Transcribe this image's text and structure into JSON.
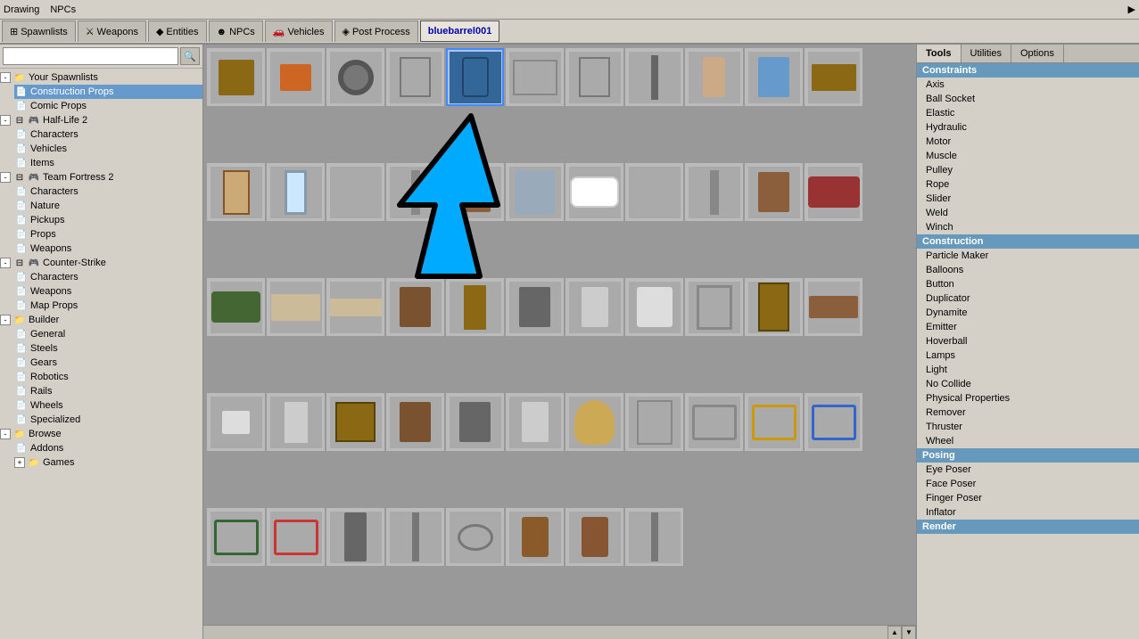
{
  "topMenu": {
    "items": [
      "Drawing",
      "NPCs"
    ],
    "arrowLabel": "▶"
  },
  "tabs": [
    {
      "label": "Spawnlists",
      "icon": "grid",
      "active": false
    },
    {
      "label": "Weapons",
      "icon": "weapon",
      "active": false
    },
    {
      "label": "Entities",
      "icon": "entity",
      "active": false
    },
    {
      "label": "NPCs",
      "icon": "npc",
      "active": false
    },
    {
      "label": "Vehicles",
      "icon": "vehicle",
      "active": false
    },
    {
      "label": "Post Process",
      "icon": "post",
      "active": false
    },
    {
      "label": "bluebarrel001",
      "icon": "tab",
      "active": true
    }
  ],
  "search": {
    "placeholder": "",
    "value": ""
  },
  "tree": {
    "sections": [
      {
        "id": "your-spawnlists",
        "label": "Your Spawnlists",
        "icon": "folder",
        "expanded": true,
        "children": [
          {
            "id": "construction-props",
            "label": "Construction Props",
            "icon": "file",
            "selected": true
          },
          {
            "id": "comic-props",
            "label": "Comic Props",
            "icon": "file",
            "selected": false
          }
        ]
      },
      {
        "id": "half-life-2",
        "label": "Half-Life 2",
        "icon": "folder",
        "expanded": true,
        "children": [
          {
            "id": "hl2-characters",
            "label": "Characters",
            "icon": "file",
            "selected": false
          },
          {
            "id": "hl2-vehicles",
            "label": "Vehicles",
            "icon": "file",
            "selected": false
          },
          {
            "id": "hl2-items",
            "label": "Items",
            "icon": "file",
            "selected": false
          }
        ]
      },
      {
        "id": "team-fortress-2",
        "label": "Team Fortress 2",
        "icon": "folder",
        "expanded": true,
        "children": [
          {
            "id": "tf2-characters",
            "label": "Characters",
            "icon": "file",
            "selected": false
          },
          {
            "id": "tf2-nature",
            "label": "Nature",
            "icon": "file",
            "selected": false
          },
          {
            "id": "tf2-pickups",
            "label": "Pickups",
            "icon": "file",
            "selected": false
          },
          {
            "id": "tf2-props",
            "label": "Props",
            "icon": "file",
            "selected": false
          },
          {
            "id": "tf2-weapons",
            "label": "Weapons",
            "icon": "file",
            "selected": false
          }
        ]
      },
      {
        "id": "counter-strike",
        "label": "Counter-Strike",
        "icon": "folder",
        "expanded": true,
        "children": [
          {
            "id": "cs-characters",
            "label": "Characters",
            "icon": "file",
            "selected": false
          },
          {
            "id": "cs-weapons",
            "label": "Weapons",
            "icon": "file",
            "selected": false
          },
          {
            "id": "cs-map-props",
            "label": "Map Props",
            "icon": "file",
            "selected": false
          }
        ]
      },
      {
        "id": "builder",
        "label": "Builder",
        "icon": "folder",
        "expanded": true,
        "children": [
          {
            "id": "builder-general",
            "label": "General",
            "icon": "file",
            "selected": false
          },
          {
            "id": "builder-steels",
            "label": "Steels",
            "icon": "file",
            "selected": false
          },
          {
            "id": "builder-gears",
            "label": "Gears",
            "icon": "file",
            "selected": false
          },
          {
            "id": "builder-robotics",
            "label": "Robotics",
            "icon": "file",
            "selected": false
          },
          {
            "id": "builder-rails",
            "label": "Rails",
            "icon": "file",
            "selected": false
          },
          {
            "id": "builder-wheels",
            "label": "Wheels",
            "icon": "file",
            "selected": false
          },
          {
            "id": "builder-specialized",
            "label": "Specialized",
            "icon": "file",
            "selected": false
          }
        ]
      },
      {
        "id": "browse",
        "label": "Browse",
        "icon": "folder",
        "expanded": true,
        "children": [
          {
            "id": "browse-addons",
            "label": "Addons",
            "icon": "file",
            "selected": false
          },
          {
            "id": "browse-games",
            "label": "Games",
            "icon": "folder",
            "selected": false
          }
        ]
      }
    ]
  },
  "rightPanel": {
    "tabs": [
      {
        "label": "Tools",
        "active": true
      },
      {
        "label": "Utilities",
        "active": false
      },
      {
        "label": "Options",
        "active": false
      }
    ],
    "sections": [
      {
        "header": "Constraints",
        "items": [
          "Axis",
          "Ball Socket",
          "Elastic",
          "Hydraulic",
          "Motor",
          "Muscle",
          "Pulley",
          "Rope",
          "Slider",
          "Weld",
          "Winch"
        ]
      },
      {
        "header": "Construction",
        "items": [
          "Particle Maker",
          "Balloons",
          "Button",
          "Duplicator",
          "Dynamite",
          "Emitter",
          "Hoverball",
          "Lamps",
          "Light",
          "No Collide",
          "Physical Properties",
          "Remover",
          "Thruster",
          "Wheel"
        ]
      },
      {
        "header": "Posing",
        "items": [
          "Eye Poser",
          "Face Poser",
          "Finger Poser",
          "Inflator"
        ]
      },
      {
        "header": "Render",
        "items": []
      }
    ]
  },
  "gridItems": [
    {
      "shape": "stool",
      "selected": false
    },
    {
      "shape": "cans",
      "selected": false
    },
    {
      "shape": "wheel",
      "selected": false
    },
    {
      "shape": "panel",
      "selected": false
    },
    {
      "shape": "barrel",
      "selected": true
    },
    {
      "shape": "fence",
      "selected": false
    },
    {
      "shape": "panel",
      "selected": false
    },
    {
      "shape": "rod",
      "selected": false
    },
    {
      "shape": "barrel2",
      "selected": false
    },
    {
      "shape": "chair",
      "selected": false
    },
    {
      "shape": "table",
      "selected": false
    },
    {
      "shape": "door",
      "selected": false
    },
    {
      "shape": "mirror",
      "selected": false
    },
    {
      "shape": "fence2",
      "selected": false
    },
    {
      "shape": "post",
      "selected": false
    },
    {
      "shape": "woodchair",
      "selected": false
    },
    {
      "shape": "fountain",
      "selected": false
    },
    {
      "shape": "tub",
      "selected": false
    },
    {
      "shape": "fence2",
      "selected": false
    },
    {
      "shape": "rod",
      "selected": false
    },
    {
      "shape": "woodchair",
      "selected": false
    },
    {
      "shape": "sofa",
      "selected": false
    },
    {
      "shape": "greensofa",
      "selected": false
    },
    {
      "shape": "mattress",
      "selected": false
    },
    {
      "shape": "flatpanel",
      "selected": false
    },
    {
      "shape": "dresser",
      "selected": false
    },
    {
      "shape": "cabinet",
      "selected": false
    },
    {
      "shape": "stove",
      "selected": false
    },
    {
      "shape": "heater",
      "selected": false
    },
    {
      "shape": "washer",
      "selected": false
    },
    {
      "shape": "gate",
      "selected": false
    },
    {
      "shape": "door2",
      "selected": false
    },
    {
      "shape": "bench",
      "selected": false
    },
    {
      "shape": "sink",
      "selected": false
    },
    {
      "shape": "fridge",
      "selected": false
    },
    {
      "shape": "crate1",
      "selected": false
    },
    {
      "shape": "dresser",
      "selected": false
    },
    {
      "shape": "stove",
      "selected": false
    },
    {
      "shape": "heater",
      "selected": false
    },
    {
      "shape": "lampshade",
      "selected": false
    },
    {
      "shape": "bars",
      "selected": false
    },
    {
      "shape": "cage",
      "selected": false
    },
    {
      "shape": "cage-yellow",
      "selected": false
    },
    {
      "shape": "cage-blue",
      "selected": false
    },
    {
      "shape": "cage-green",
      "selected": false
    },
    {
      "shape": "cage-red",
      "selected": false
    },
    {
      "shape": "tower",
      "selected": false
    },
    {
      "shape": "post2",
      "selected": false
    },
    {
      "shape": "pipe",
      "selected": false
    },
    {
      "shape": "barrel3",
      "selected": false
    },
    {
      "shape": "rusted",
      "selected": false
    },
    {
      "shape": "post2",
      "selected": false
    }
  ]
}
